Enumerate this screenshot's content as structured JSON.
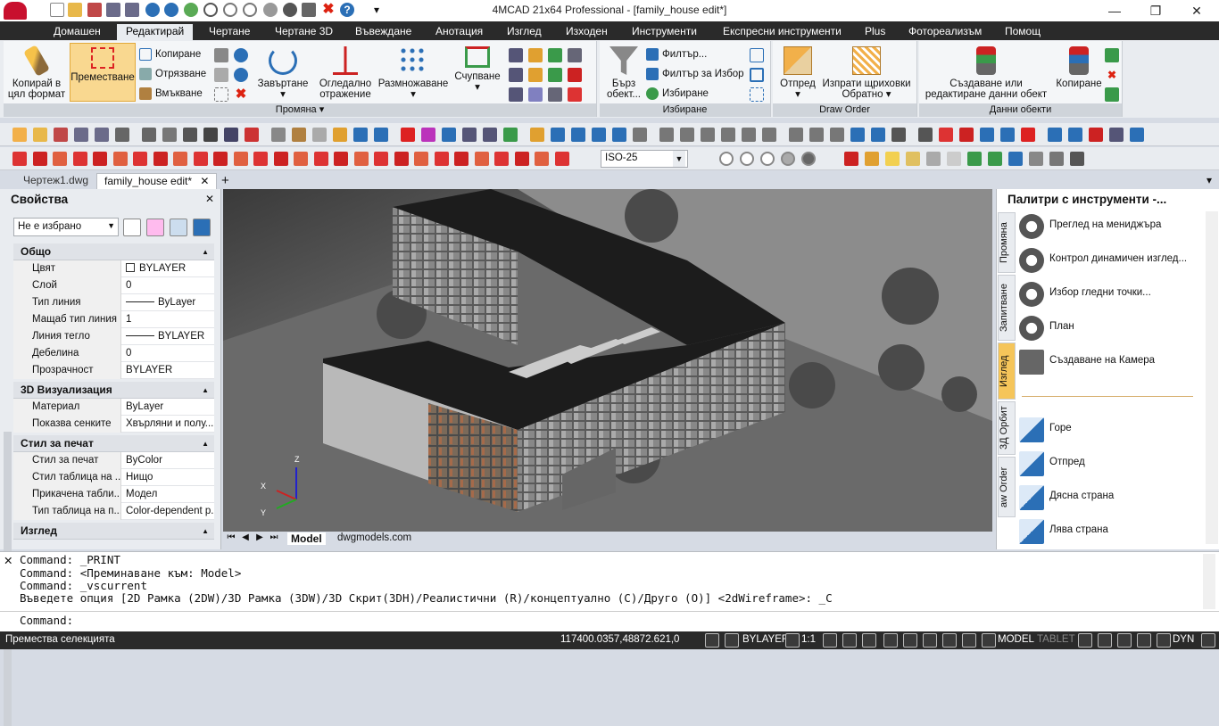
{
  "window": {
    "title": "4MCAD 21x64 Professional - [family_house edit*]"
  },
  "menu": [
    "Домашен",
    "Редактирай",
    "Чертане",
    "Чертане 3D",
    "Въвеждане",
    "Анотация",
    "Изглед",
    "Изходен",
    "Инструменти",
    "Експресни инструменти",
    "Plus",
    "Фотореализъм",
    "Помощ"
  ],
  "menu_active": "Редактирай",
  "ribbon": {
    "copy_format": "Копирай в цял формат",
    "move": "Преместване",
    "copy": "Копиране",
    "cut": "Отрязване",
    "paste": "Вмъкване",
    "rotate": "Завъртане",
    "mirror": "Огледално отражение",
    "array": "Размножаване",
    "explode": "Счупване",
    "group_modify": "Промяна",
    "quick_select": "Бърз обект...",
    "filter": "Филтър...",
    "filter_select": "Филтър за Избор",
    "select": "Избиране",
    "group_select": "Избиране",
    "front": "Отпред",
    "send_hatch": "Изпрати щриховки Обратно",
    "group_draw_order": "Draw Order",
    "create_data": "Създаване или редактиране данни обект",
    "copy_data": "Копиране",
    "group_data": "Данни обекти"
  },
  "toolbar": {
    "dimstyle": "ISO-25"
  },
  "doc_tabs": [
    "Чертеж1.dwg",
    "family_house edit*"
  ],
  "props": {
    "title": "Свойства",
    "selection": "Не е избрано",
    "sections": [
      {
        "name": "Общо",
        "rows": [
          [
            "Цвят",
            "BYLAYER"
          ],
          [
            "Слой",
            "0"
          ],
          [
            "Тип линия",
            "ByLayer"
          ],
          [
            "Мащаб тип линия",
            "1"
          ],
          [
            "Линия тегло",
            "BYLAYER"
          ],
          [
            "Дебелина",
            "0"
          ],
          [
            "Прозрачност",
            "BYLAYER"
          ]
        ]
      },
      {
        "name": "3D Визуализация",
        "rows": [
          [
            "Материал",
            "ByLayer"
          ],
          [
            "Показва сенките",
            "Хвърляни и полу..."
          ]
        ]
      },
      {
        "name": "Стил за печат",
        "rows": [
          [
            "Стил за печат",
            "ByColor"
          ],
          [
            "Стил таблица на ...",
            "Нищо"
          ],
          [
            "Прикачена табли...",
            "Модел"
          ],
          [
            "Тип таблица на п...",
            "Color-dependent p..."
          ]
        ]
      },
      {
        "name": "Изглед",
        "rows": []
      }
    ]
  },
  "layout_tabs": [
    "Model",
    "dwgmodels.com"
  ],
  "palette": {
    "title": "Палитри с инструменти -...",
    "vtabs": [
      "Промяна",
      "Запитване",
      "Изглед",
      "3Д Орбит",
      "aw Order"
    ],
    "items": [
      "Преглед на мениджъра",
      "Контрол динамичен изглед...",
      "Избор гледни точки...",
      "План",
      "Създаване на Камера",
      "Горе",
      "Отпред",
      "Дясна страна",
      "Лява страна"
    ]
  },
  "command": {
    "lines": [
      "Command: _PRINT",
      "Command: <Преминаване към: Model>",
      "Command: _vscurrent",
      "Въведете опция [2D Рамка (2DW)/3D Рамка (3DW)/3D Скрит(3DH)/Реалистични (R)/концептуално (C)/Друго (O)] <2dWireframe>: _C"
    ],
    "prompt": "Command:"
  },
  "status": {
    "left": "Премества селекцията",
    "coords": "117400.0357,48872.621,0",
    "layer": "BYLAYER",
    "scale": "1:1",
    "model": "MODEL",
    "tablet": "TABLET",
    "dyn": "DYN"
  },
  "colors": {
    "accent": "#f5c55a",
    "dark": "#2a2a2a"
  }
}
